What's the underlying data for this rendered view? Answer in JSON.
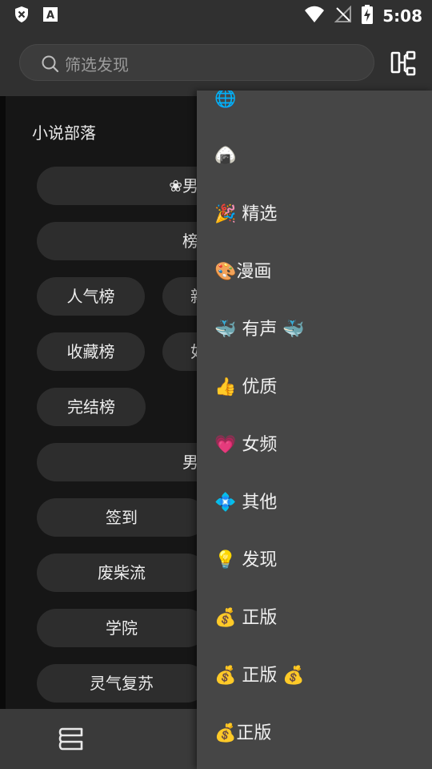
{
  "status_bar": {
    "time": "5:08",
    "icons": [
      "shield-x-icon",
      "keyboard-a-icon",
      "wifi-icon",
      "no-signal-icon",
      "battery-charging-icon"
    ]
  },
  "header": {
    "search_placeholder": "筛选发现",
    "action_icon": "layout-switch-icon"
  },
  "content": {
    "section_title": "小说部落",
    "chips": [
      {
        "label": "❀男"
      },
      {
        "label": "榜"
      },
      {
        "label": "人气榜"
      },
      {
        "label": "新"
      },
      {
        "label": "收藏榜"
      },
      {
        "label": "如"
      },
      {
        "label": "完结榜"
      },
      {
        "label": "男"
      },
      {
        "label": "签到"
      },
      {
        "label": "废柴流"
      },
      {
        "label": "学院"
      },
      {
        "label": "灵气复苏"
      }
    ]
  },
  "drawer": {
    "items": [
      {
        "label": "🌐"
      },
      {
        "label": "🍙"
      },
      {
        "label": "🎉 精选"
      },
      {
        "label": "🎨漫画"
      },
      {
        "label": "🐳 有声 🐳"
      },
      {
        "label": "👍 优质"
      },
      {
        "label": "💗 女频"
      },
      {
        "label": "💠 其他"
      },
      {
        "label": "💡 发现"
      },
      {
        "label": "💰 正版"
      },
      {
        "label": "💰 正版 💰"
      },
      {
        "label": "💰正版"
      }
    ]
  },
  "bottom_nav": {
    "icon": "bookshelf-icon"
  }
}
